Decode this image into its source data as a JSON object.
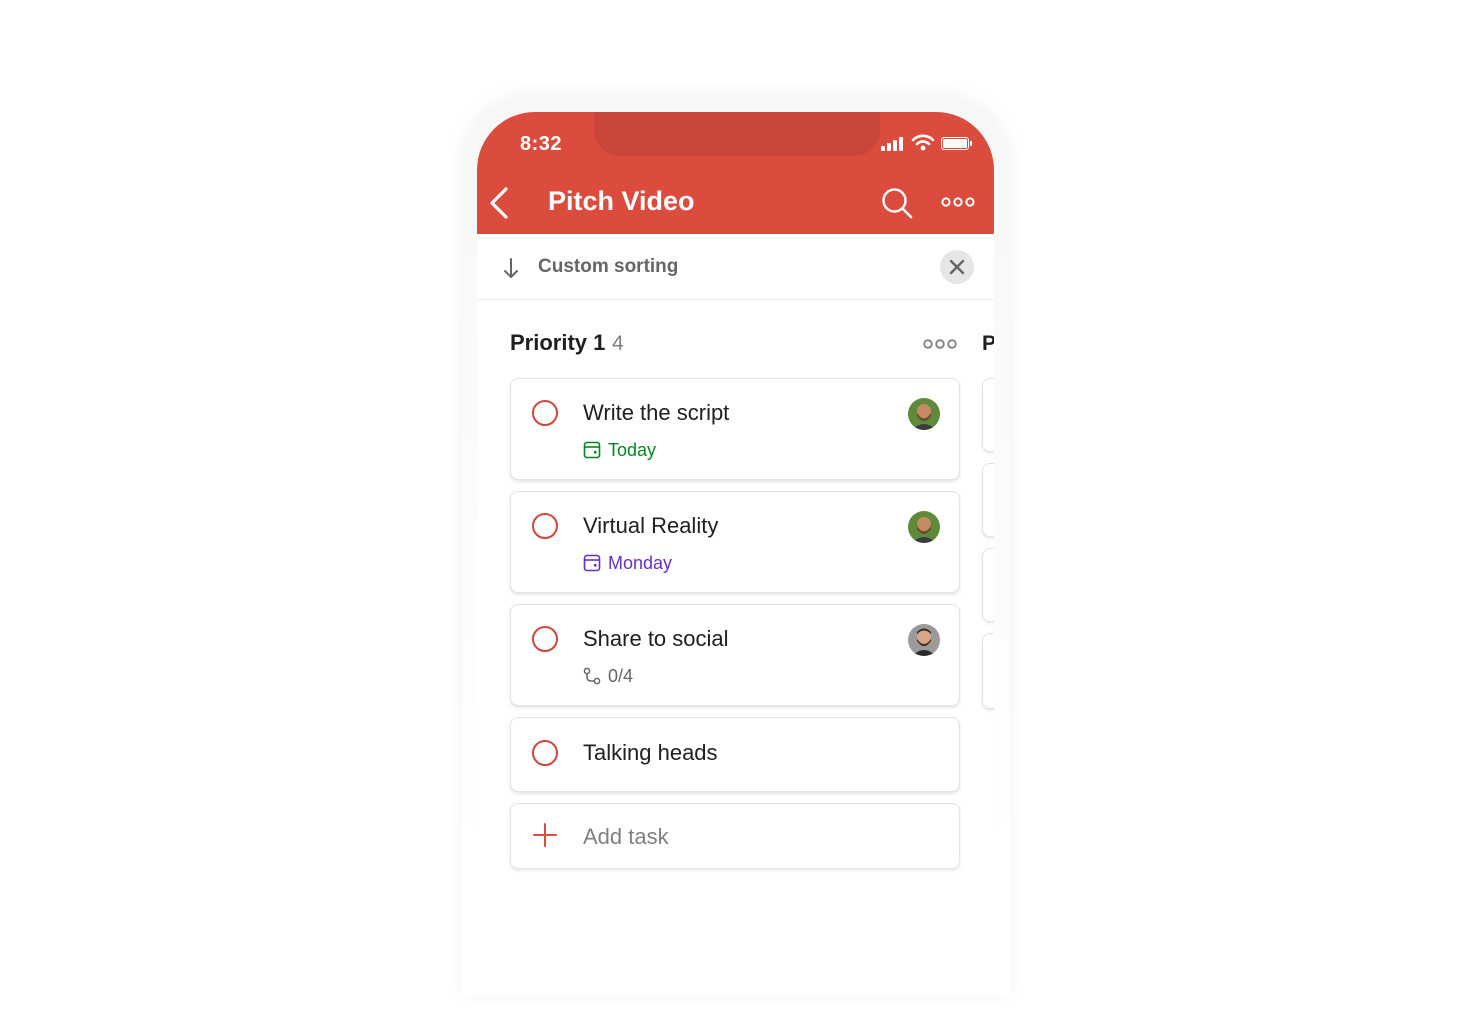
{
  "status_bar": {
    "time": "8:32"
  },
  "header": {
    "title": "Pitch Video"
  },
  "sort_bar": {
    "label": "Custom sorting"
  },
  "section": {
    "title": "Priority 1",
    "count": "4",
    "next_section_initial": "P"
  },
  "tasks": [
    {
      "title": "Write the script",
      "meta": "Today",
      "meta_type": "date",
      "meta_color": "#058527",
      "avatar": "user-avatar"
    },
    {
      "title": "Virtual Reality",
      "meta": "Monday",
      "meta_type": "date",
      "meta_color": "#692fc2",
      "avatar": "user-avatar"
    },
    {
      "title": "Share to social",
      "meta": "0/4",
      "meta_type": "subtasks",
      "meta_color": "#666666",
      "avatar": "user-avatar"
    },
    {
      "title": "Talking heads"
    }
  ],
  "add_task": {
    "label": "Add task"
  },
  "colors": {
    "brand": "#dc4c3e",
    "priority_1": "#d1453b"
  }
}
